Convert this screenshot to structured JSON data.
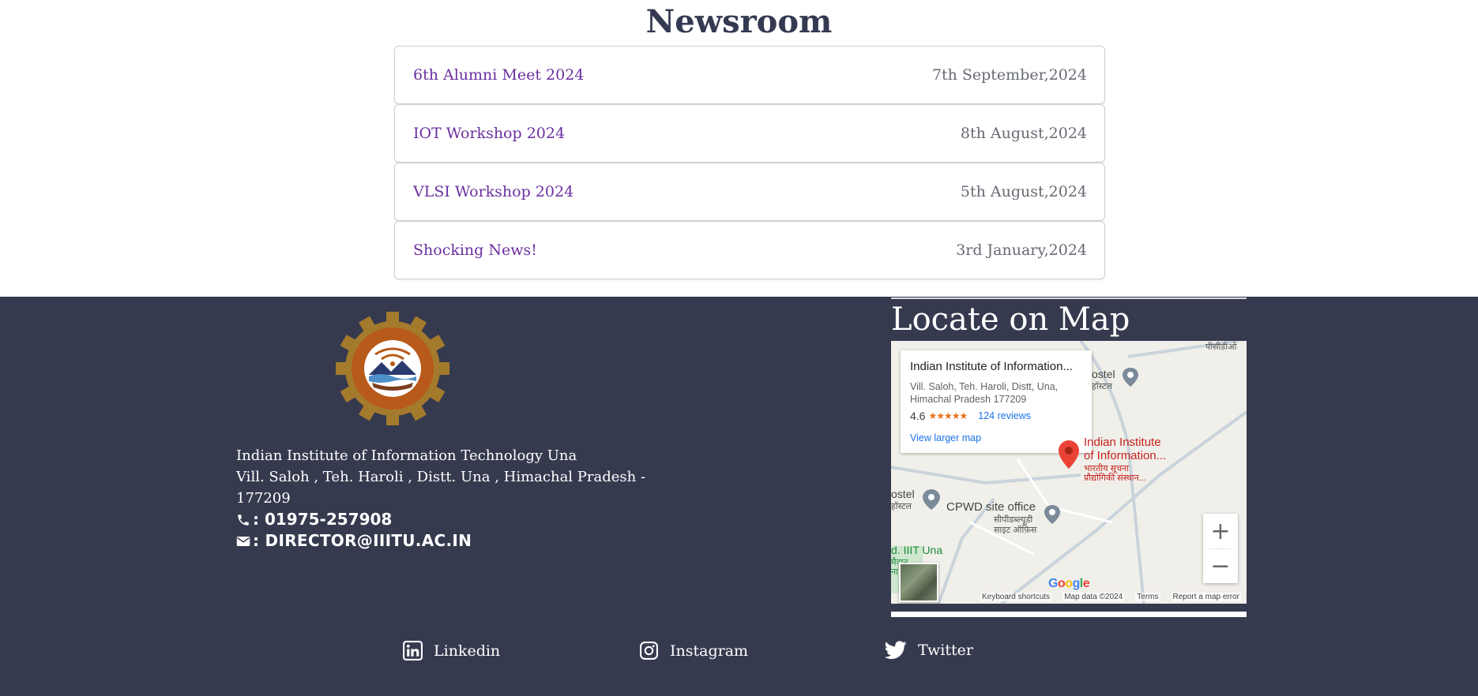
{
  "newsroom": {
    "title": "Newsroom",
    "items": [
      {
        "title": "6th Alumni Meet 2024",
        "date": "7th September,2024"
      },
      {
        "title": "IOT Workshop 2024",
        "date": "8th August,2024"
      },
      {
        "title": "VLSI Workshop 2024",
        "date": "5th August,2024"
      },
      {
        "title": "Shocking News!",
        "date": "3rd January,2024"
      }
    ]
  },
  "footer": {
    "logo_icon": "iiit-una-logo",
    "address_line1": "Indian Institute of Information Technology Una",
    "address_line2": "Vill. Saloh , Teh. Haroli , Distt. Una , Himachal Pradesh -",
    "address_line3": "177209",
    "phone": ": 01975-257908",
    "phone_icon": "phone-icon",
    "email": ": director@iiitu.ac.in",
    "email_icon": "envelope-icon"
  },
  "map": {
    "heading": "Locate on Map",
    "card": {
      "name": "Indian Institute of Information...",
      "address": "Vill. Saloh, Teh. Haroli, Distt, Una, Himachal Pradesh 177209",
      "rating": "4.6",
      "stars": "★★★★★",
      "reviews": "124 reviews",
      "larger_map": "View larger map"
    },
    "labels": {
      "pwd": "पीसीडीओ",
      "hostel1": "ostel",
      "hostel1_hi": "हॉस्टल",
      "institute1": "Indian Institute",
      "institute2": "of Information...",
      "institute_hi1": "भारतीय सूचना",
      "institute_hi2": "प्रौद्योगिकी संस्थान...",
      "hostel2": "ostel",
      "hostel2_hi": "हॉस्टल",
      "cpwd": "CPWD site office",
      "cpwd_hi1": "सीपीडब्ल्यूडी",
      "cpwd_hi2": "साइट ऑफ़िस",
      "iiit_una": "d. IIIT Una",
      "iiit_una_hi1": "मैदान",
      "iiit_una_hi2": "ना"
    },
    "google": "Google",
    "footer": {
      "shortcuts": "Keyboard shortcuts",
      "data": "Map data ©2024",
      "terms": "Terms",
      "report": "Report a map error"
    },
    "zoom_in": "+",
    "zoom_out": "−"
  },
  "socials": [
    {
      "label": "Linkedin",
      "icon": "linkedin-icon"
    },
    {
      "label": "Instagram",
      "icon": "instagram-icon"
    },
    {
      "label": "Twitter",
      "icon": "twitter-icon"
    }
  ],
  "colors": {
    "footer_bg": "#363a4f",
    "news_link": "#6b2fa0",
    "heading": "#343a52"
  }
}
